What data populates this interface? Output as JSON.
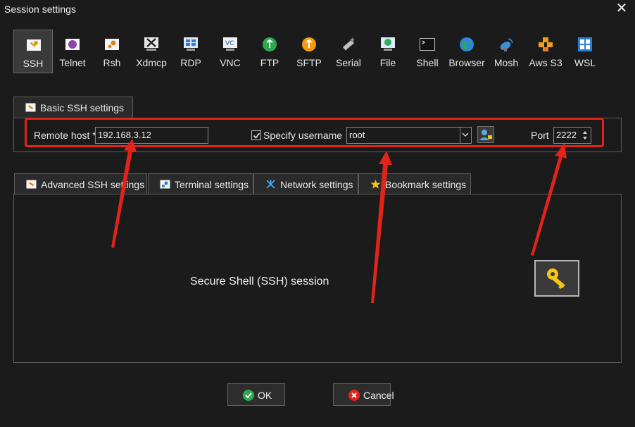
{
  "window": {
    "title": "Session settings"
  },
  "protocols": [
    {
      "label": "SSH",
      "icon": "ssh-key-icon"
    },
    {
      "label": "Telnet",
      "icon": "telnet-icon"
    },
    {
      "label": "Rsh",
      "icon": "rsh-icon"
    },
    {
      "label": "Xdmcp",
      "icon": "xdmcp-icon"
    },
    {
      "label": "RDP",
      "icon": "rdp-icon"
    },
    {
      "label": "VNC",
      "icon": "vnc-icon"
    },
    {
      "label": "FTP",
      "icon": "ftp-icon"
    },
    {
      "label": "SFTP",
      "icon": "sftp-icon"
    },
    {
      "label": "Serial",
      "icon": "serial-icon"
    },
    {
      "label": "File",
      "icon": "file-icon"
    },
    {
      "label": "Shell",
      "icon": "shell-icon"
    },
    {
      "label": "Browser",
      "icon": "browser-icon"
    },
    {
      "label": "Mosh",
      "icon": "mosh-icon"
    },
    {
      "label": "Aws S3",
      "icon": "aws-s3-icon"
    },
    {
      "label": "WSL",
      "icon": "wsl-icon"
    }
  ],
  "basic": {
    "tab_label": "Basic SSH settings",
    "remote_host_label": "Remote host *",
    "remote_host_value": "192.168.3.12",
    "specify_username_label": "Specify username",
    "specify_username_checked": true,
    "username_value": "root",
    "port_label": "Port",
    "port_value": "2222"
  },
  "tabs": [
    {
      "label": "Advanced SSH settings",
      "icon": "wrench-icon"
    },
    {
      "label": "Terminal settings",
      "icon": "terminal-icon"
    },
    {
      "label": "Network settings",
      "icon": "network-icon"
    },
    {
      "label": "Bookmark settings",
      "icon": "star-icon"
    }
  ],
  "main": {
    "session_text": "Secure Shell (SSH) session"
  },
  "buttons": {
    "ok": "OK",
    "cancel": "Cancel"
  },
  "colors": {
    "annotation_red": "#e2231a",
    "accent_gold": "#f5c518",
    "background": "#1b1b1b"
  }
}
